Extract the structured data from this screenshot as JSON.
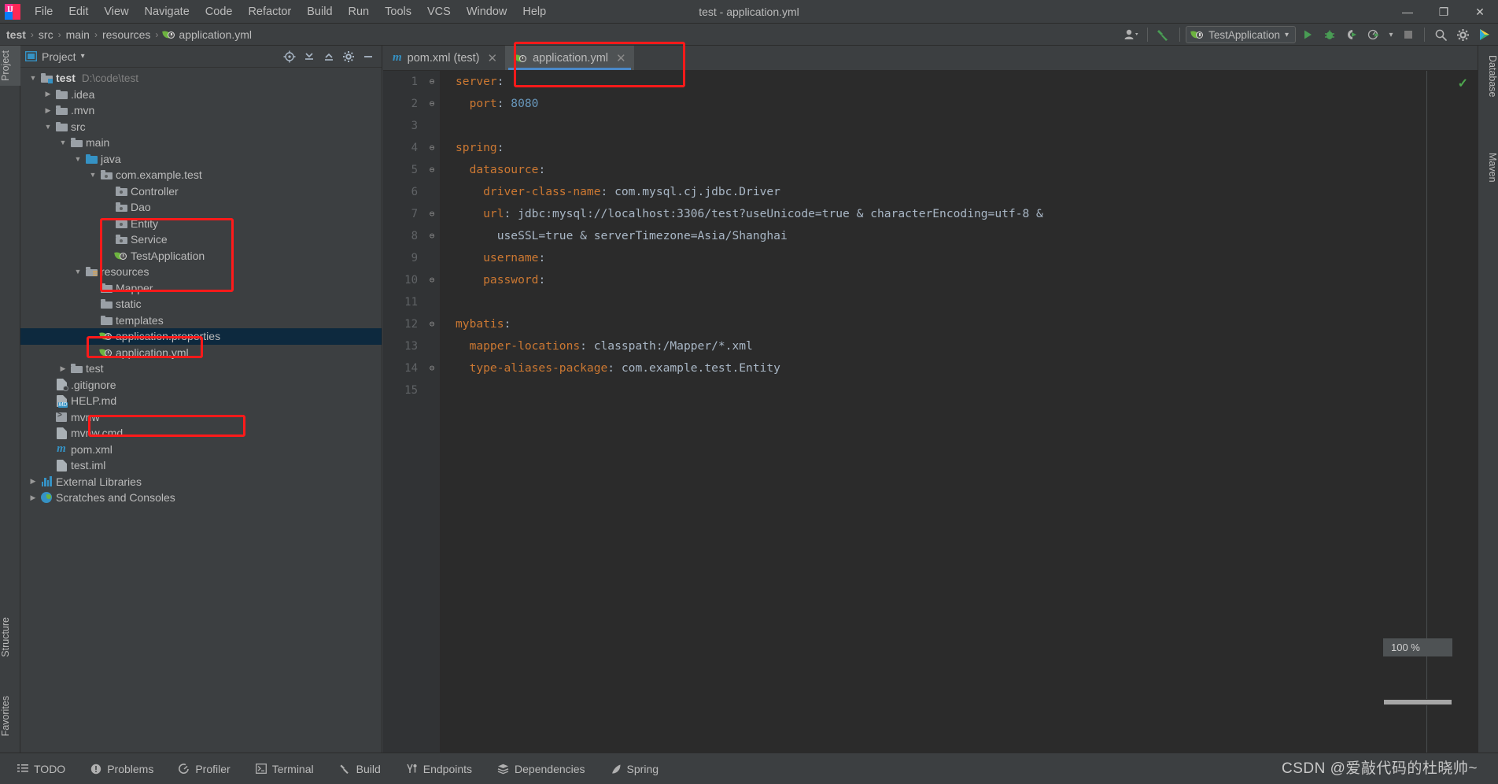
{
  "window": {
    "title": "test - application.yml",
    "minimize": "—",
    "maximize": "❐",
    "close": "✕"
  },
  "menubar": {
    "items": [
      {
        "label": "File"
      },
      {
        "label": "Edit"
      },
      {
        "label": "View"
      },
      {
        "label": "Navigate"
      },
      {
        "label": "Code"
      },
      {
        "label": "Refactor"
      },
      {
        "label": "Build"
      },
      {
        "label": "Run"
      },
      {
        "label": "Tools"
      },
      {
        "label": "VCS"
      },
      {
        "label": "Window"
      },
      {
        "label": "Help"
      }
    ]
  },
  "breadcrumb": {
    "separator": "›",
    "items": [
      {
        "label": "test",
        "icon": "none"
      },
      {
        "label": "src",
        "icon": "none"
      },
      {
        "label": "main",
        "icon": "none"
      },
      {
        "label": "resources",
        "icon": "none"
      },
      {
        "label": "application.yml",
        "icon": "spring-icon"
      }
    ]
  },
  "toolbar": {
    "account_icon": "account-icon",
    "build_icon": "hammer-build-icon",
    "run_config": {
      "icon": "spring-icon",
      "label": "TestApplication",
      "caret": "▾"
    },
    "run_icon": "run-icon",
    "debug_icon": "debug-icon",
    "run_coverage_icon": "run-with-coverage-icon",
    "profiler_icon": "profiler-icon",
    "profiler_caret": "▾",
    "stop_icon": "stop-icon",
    "search_icon": "search-everywhere-icon",
    "settings_icon": "gear-icon",
    "updates_icon": "ide-updates-icon"
  },
  "left_stripe": {
    "tabs": [
      {
        "label": "Project",
        "active": true
      },
      {
        "label": "Structure",
        "active": false
      },
      {
        "label": "Favorites",
        "active": false
      }
    ]
  },
  "right_stripe": {
    "tabs": [
      {
        "label": "Database"
      },
      {
        "label": "Maven"
      }
    ]
  },
  "project_panel": {
    "title": "Project",
    "title_caret": "▾",
    "icons": [
      {
        "name": "select-opened-file-icon",
        "glyph": "⊕"
      },
      {
        "name": "expand-all-icon",
        "glyph": "↧"
      },
      {
        "name": "collapse-all-icon",
        "glyph": "↥"
      },
      {
        "name": "settings-gear-icon",
        "glyph": "⚙"
      },
      {
        "name": "hide-panel-icon",
        "glyph": "—"
      }
    ],
    "tree": [
      {
        "label": "test",
        "sub": "D:\\code\\test",
        "indent": 0,
        "arrow": "down",
        "icon": "module-folder",
        "bold": true,
        "selected": false
      },
      {
        "label": ".idea",
        "sub": "",
        "indent": 1,
        "arrow": "right",
        "icon": "folder",
        "bold": false,
        "selected": false
      },
      {
        "label": ".mvn",
        "sub": "",
        "indent": 1,
        "arrow": "right",
        "icon": "folder",
        "bold": false,
        "selected": false
      },
      {
        "label": "src",
        "sub": "",
        "indent": 1,
        "arrow": "down",
        "icon": "folder",
        "bold": false,
        "selected": false
      },
      {
        "label": "main",
        "sub": "",
        "indent": 2,
        "arrow": "down",
        "icon": "folder",
        "bold": false,
        "selected": false
      },
      {
        "label": "java",
        "sub": "",
        "indent": 3,
        "arrow": "down",
        "icon": "source-folder",
        "bold": false,
        "selected": false
      },
      {
        "label": "com.example.test",
        "sub": "",
        "indent": 4,
        "arrow": "down",
        "icon": "package",
        "bold": false,
        "selected": false
      },
      {
        "label": "Controller",
        "sub": "",
        "indent": 5,
        "arrow": "none",
        "icon": "package",
        "bold": false,
        "selected": false
      },
      {
        "label": "Dao",
        "sub": "",
        "indent": 5,
        "arrow": "none",
        "icon": "package",
        "bold": false,
        "selected": false
      },
      {
        "label": "Entity",
        "sub": "",
        "indent": 5,
        "arrow": "none",
        "icon": "package",
        "bold": false,
        "selected": false
      },
      {
        "label": "Service",
        "sub": "",
        "indent": 5,
        "arrow": "none",
        "icon": "package",
        "bold": false,
        "selected": false
      },
      {
        "label": "TestApplication",
        "sub": "",
        "indent": 5,
        "arrow": "none",
        "icon": "spring-class",
        "bold": false,
        "selected": false
      },
      {
        "label": "resources",
        "sub": "",
        "indent": 3,
        "arrow": "down",
        "icon": "resource-folder",
        "bold": false,
        "selected": false
      },
      {
        "label": "Mapper",
        "sub": "",
        "indent": 4,
        "arrow": "none",
        "icon": "folder",
        "bold": false,
        "selected": false
      },
      {
        "label": "static",
        "sub": "",
        "indent": 4,
        "arrow": "none",
        "icon": "folder",
        "bold": false,
        "selected": false
      },
      {
        "label": "templates",
        "sub": "",
        "indent": 4,
        "arrow": "none",
        "icon": "folder",
        "bold": false,
        "selected": false
      },
      {
        "label": "application.properties",
        "sub": "",
        "indent": 4,
        "arrow": "none",
        "icon": "spring-file",
        "bold": false,
        "selected": true
      },
      {
        "label": "application.yml",
        "sub": "",
        "indent": 4,
        "arrow": "none",
        "icon": "spring-file",
        "bold": false,
        "selected": false
      },
      {
        "label": "test",
        "sub": "",
        "indent": 2,
        "arrow": "right",
        "icon": "folder",
        "bold": false,
        "selected": false
      },
      {
        "label": ".gitignore",
        "sub": "",
        "indent": 1,
        "arrow": "none",
        "icon": "gitignore-file",
        "bold": false,
        "selected": false
      },
      {
        "label": "HELP.md",
        "sub": "",
        "indent": 1,
        "arrow": "none",
        "icon": "markdown-file",
        "bold": false,
        "selected": false
      },
      {
        "label": "mvnw",
        "sub": "",
        "indent": 1,
        "arrow": "none",
        "icon": "script-file",
        "bold": false,
        "selected": false
      },
      {
        "label": "mvnw.cmd",
        "sub": "",
        "indent": 1,
        "arrow": "none",
        "icon": "cmd-file",
        "bold": false,
        "selected": false
      },
      {
        "label": "pom.xml",
        "sub": "",
        "indent": 1,
        "arrow": "none",
        "icon": "maven-file",
        "bold": false,
        "selected": false
      },
      {
        "label": "test.iml",
        "sub": "",
        "indent": 1,
        "arrow": "none",
        "icon": "iml-file",
        "bold": false,
        "selected": false
      },
      {
        "label": "External Libraries",
        "sub": "",
        "indent": 0,
        "arrow": "right",
        "icon": "libraries",
        "bold": false,
        "selected": false
      },
      {
        "label": "Scratches and Consoles",
        "sub": "",
        "indent": 0,
        "arrow": "right",
        "icon": "scratches",
        "bold": false,
        "selected": false
      }
    ]
  },
  "editor": {
    "tabs": [
      {
        "label": "pom.xml (test)",
        "icon": "maven-icon",
        "active": false,
        "close": "✕"
      },
      {
        "label": "application.yml",
        "icon": "spring-icon",
        "active": true,
        "close": "✕"
      }
    ],
    "inspection_status": "✓",
    "zoom_level": "100 %",
    "lines": [
      {
        "n": "1",
        "fold": "⊖",
        "indent": 0,
        "key": "server",
        "colon": ":",
        "value": "",
        "vtype": "none"
      },
      {
        "n": "2",
        "fold": "⊖",
        "indent": 2,
        "key": "port",
        "colon": ":",
        "value": " 8080",
        "vtype": "num"
      },
      {
        "n": "3",
        "fold": "",
        "indent": 0,
        "key": "",
        "colon": "",
        "value": "",
        "vtype": "none"
      },
      {
        "n": "4",
        "fold": "⊖",
        "indent": 0,
        "key": "spring",
        "colon": ":",
        "value": "",
        "vtype": "none"
      },
      {
        "n": "5",
        "fold": "⊖",
        "indent": 2,
        "key": "datasource",
        "colon": ":",
        "value": "",
        "vtype": "none"
      },
      {
        "n": "6",
        "fold": "",
        "indent": 4,
        "key": "driver-class-name",
        "colon": ":",
        "value": " com.mysql.cj.jdbc.Driver",
        "vtype": "text"
      },
      {
        "n": "7",
        "fold": "⊖",
        "indent": 4,
        "key": "url",
        "colon": ":",
        "value": " jdbc:mysql://localhost:3306/test?useUnicode=true & characterEncoding=utf-8 &",
        "vtype": "text"
      },
      {
        "n": "8",
        "fold": "⊖",
        "indent": 6,
        "key": "",
        "colon": "",
        "value": "useSSL=true & serverTimezone=Asia/Shanghai",
        "vtype": "text"
      },
      {
        "n": "9",
        "fold": "",
        "indent": 4,
        "key": "username",
        "colon": ":",
        "value": "",
        "vtype": "none"
      },
      {
        "n": "10",
        "fold": "⊖",
        "indent": 4,
        "key": "password",
        "colon": ":",
        "value": "",
        "vtype": "none"
      },
      {
        "n": "11",
        "fold": "",
        "indent": 0,
        "key": "",
        "colon": "",
        "value": "",
        "vtype": "none"
      },
      {
        "n": "12",
        "fold": "⊖",
        "indent": 0,
        "key": "mybatis",
        "colon": ":",
        "value": "",
        "vtype": "none"
      },
      {
        "n": "13",
        "fold": "",
        "indent": 2,
        "key": "mapper-locations",
        "colon": ":",
        "value": " classpath:/Mapper/*.xml",
        "vtype": "text"
      },
      {
        "n": "14",
        "fold": "⊖",
        "indent": 2,
        "key": "type-aliases-package",
        "colon": ":",
        "value": " com.example.test.Entity",
        "vtype": "text"
      },
      {
        "n": "15",
        "fold": "",
        "indent": 0,
        "key": "",
        "colon": "",
        "value": "",
        "vtype": "none"
      }
    ]
  },
  "bottom_bar": {
    "items": [
      {
        "label": "TODO",
        "icon": "todo-icon"
      },
      {
        "label": "Problems",
        "icon": "problems-icon"
      },
      {
        "label": "Profiler",
        "icon": "profiler-icon"
      },
      {
        "label": "Terminal",
        "icon": "terminal-icon"
      },
      {
        "label": "Build",
        "icon": "build-hammer-icon"
      },
      {
        "label": "Endpoints",
        "icon": "endpoints-icon"
      },
      {
        "label": "Dependencies",
        "icon": "dependencies-icon"
      },
      {
        "label": "Spring",
        "icon": "spring-leaf-icon"
      }
    ]
  },
  "watermark": {
    "text": "CSDN @爱敲代码的杜晓帅~"
  },
  "colors": {
    "accent_blue": "#4a88c7",
    "selection": "#0d293e",
    "annotation_red": "#ff1a1a",
    "yaml_key": "#cc7832",
    "yaml_number": "#6897bb",
    "yaml_text": "#a9b7c6",
    "editor_bg": "#2b2b2b",
    "panel_bg": "#3c3f41",
    "spring_green": "#6db33f"
  }
}
